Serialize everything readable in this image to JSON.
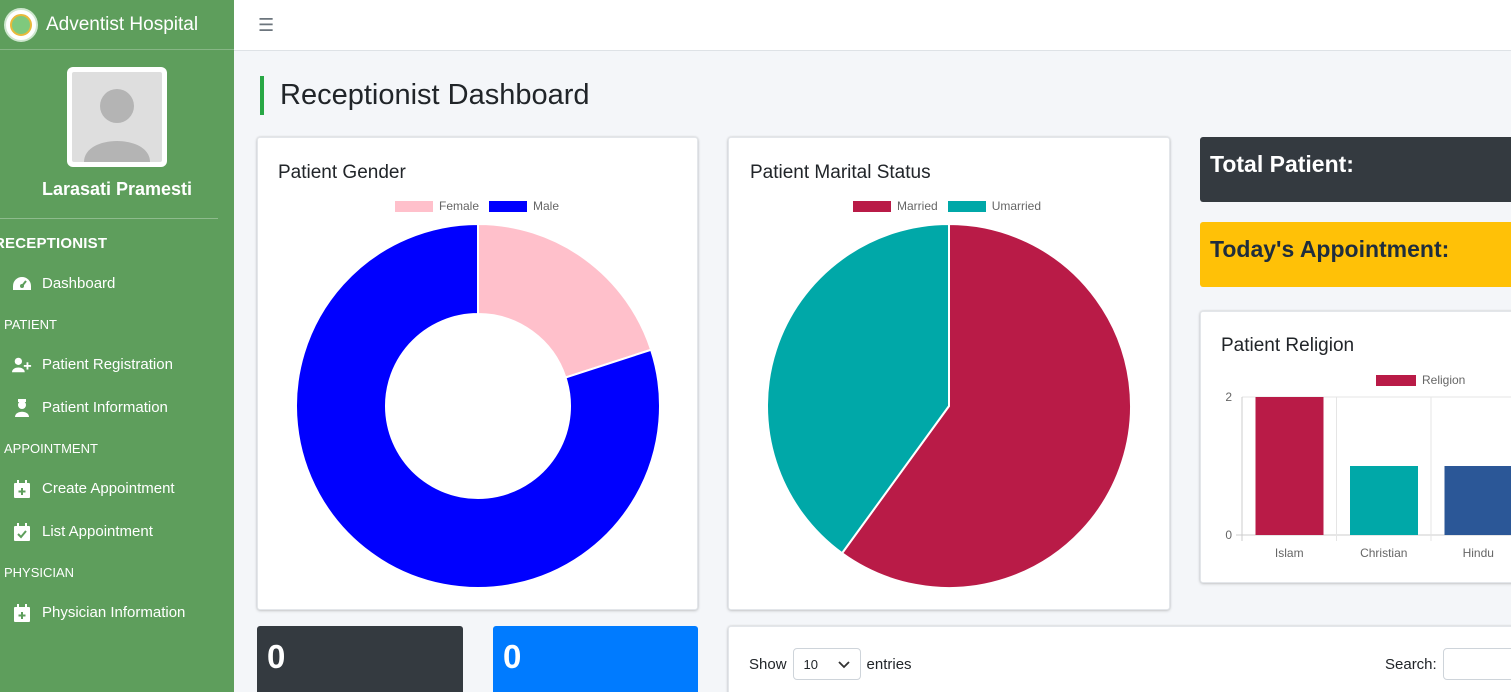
{
  "brand": {
    "name": "Adventist Hospital"
  },
  "user": {
    "name": "Larasati Pramesti",
    "role": "RECEPTIONIST"
  },
  "sidebar": {
    "items": [
      {
        "label": "Dashboard",
        "icon": "tachometer-icon"
      },
      {
        "header": "PATIENT"
      },
      {
        "label": "Patient Registration",
        "icon": "user-plus-icon"
      },
      {
        "label": "Patient Information",
        "icon": "user-nurse-icon"
      },
      {
        "header": "APPOINTMENT"
      },
      {
        "label": "Create Appointment",
        "icon": "calendar-plus-icon"
      },
      {
        "label": "List Appointment",
        "icon": "calendar-check-icon"
      },
      {
        "header": "PHYSICIAN"
      },
      {
        "label": "Physician Information",
        "icon": "calendar-plus-icon"
      }
    ]
  },
  "page": {
    "title": "Receptionist Dashboard"
  },
  "stats": {
    "total_patient_label": "Total Patient:",
    "todays_appointment_label": "Today's Appointment:",
    "box1_value": "0",
    "box2_value": "0"
  },
  "table_controls": {
    "show_label": "Show",
    "entries_value": "10",
    "entries_label": "entries",
    "search_label": "Search:"
  },
  "colors": {
    "sidebar": "#5e9e5c",
    "female": "#ffc0cb",
    "male": "#0000ff",
    "married": "#b91b47",
    "unmarried": "#00a8a8",
    "islam": "#b91b47",
    "christian": "#00a8a8",
    "hindu": "#2b5797",
    "dark_box": "#343a40",
    "warning_box": "#ffc107",
    "primary_box": "#007bff"
  },
  "chart_data": [
    {
      "type": "pie",
      "title": "Patient Gender",
      "variant": "doughnut",
      "labels": [
        "Female",
        "Male"
      ],
      "values": [
        1,
        4
      ],
      "legend": "top"
    },
    {
      "type": "pie",
      "title": "Patient Marital Status",
      "labels": [
        "Married",
        "Umarried"
      ],
      "values": [
        3,
        2
      ],
      "legend": "top"
    },
    {
      "type": "bar",
      "title": "Patient Religion",
      "categories": [
        "Islam",
        "Christian",
        "Hindu"
      ],
      "series": [
        {
          "name": "Religion",
          "values": [
            2,
            1,
            1
          ]
        }
      ],
      "yticks": [
        "0",
        "2"
      ],
      "ylim": [
        0,
        2
      ],
      "legend": "top"
    }
  ]
}
